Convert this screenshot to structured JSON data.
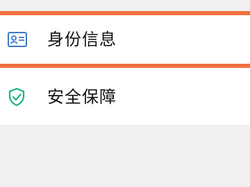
{
  "list": {
    "items": [
      {
        "label": "身份信息",
        "icon": "id-card-icon",
        "selected": true
      },
      {
        "label": "安全保障",
        "icon": "shield-check-icon",
        "selected": false
      }
    ]
  },
  "colors": {
    "background": "#f0f0f0",
    "row_background": "#ffffff",
    "highlight_border": "#f27140",
    "id_icon": "#3a78c9",
    "shield_icon": "#1ab47a",
    "text": "#111111"
  }
}
